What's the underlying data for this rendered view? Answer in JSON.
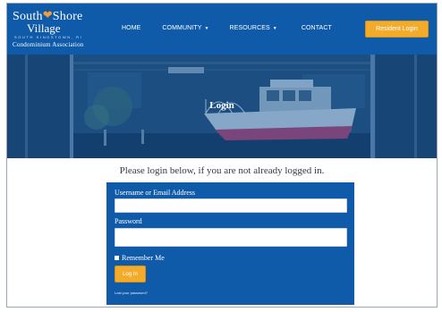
{
  "logo": {
    "line1_part1": "South",
    "line1_part2": "Shore",
    "line2": "Village",
    "line3": "SOUTH KINGSTOWN, RI",
    "line4": "Condominium Association"
  },
  "nav": {
    "items": [
      {
        "label": "HOME",
        "has_dropdown": false
      },
      {
        "label": "COMMUNITY",
        "has_dropdown": true
      },
      {
        "label": "RESOURCES",
        "has_dropdown": true
      },
      {
        "label": "CONTACT",
        "has_dropdown": false
      }
    ],
    "caret": "▼"
  },
  "header": {
    "resident_login_label": "Resident Login"
  },
  "hero": {
    "title": "Login"
  },
  "intro": {
    "text": "Please login below, if you are not already logged in."
  },
  "login_form": {
    "username_label": "Username or Email Address",
    "username_value": "",
    "password_label": "Password",
    "password_value": "",
    "remember_label": "Remember Me",
    "login_button_label": "Log In",
    "lost_password_label": "Lost your password?"
  },
  "colors": {
    "brand_blue": "#0f5ba9",
    "accent_orange": "#f2ab2b",
    "heart_orange": "#f2a033"
  }
}
